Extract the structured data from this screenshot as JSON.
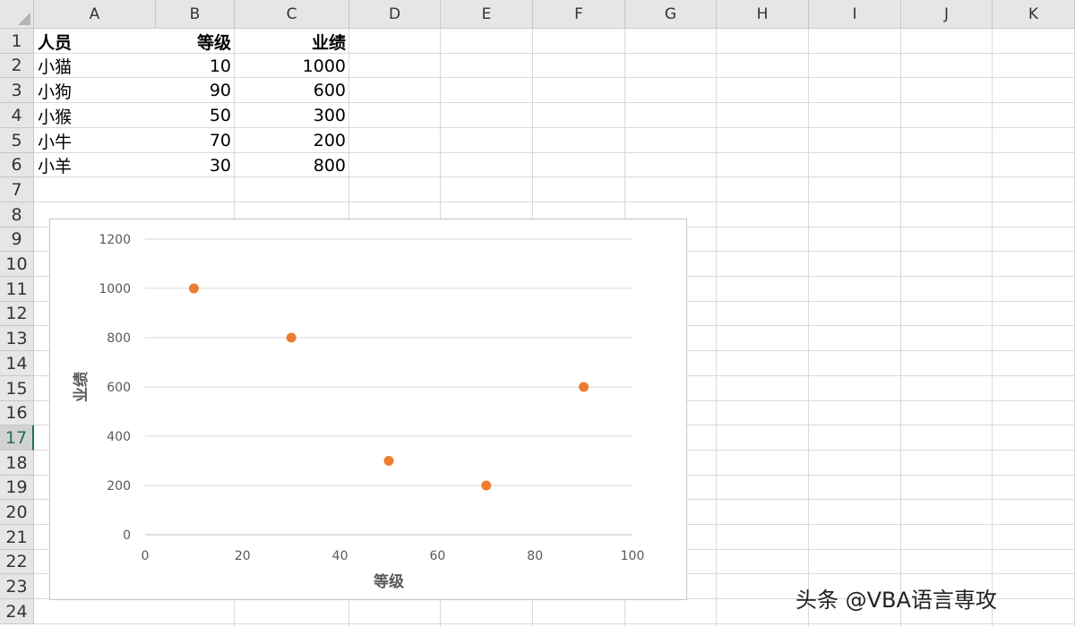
{
  "columns": [
    "A",
    "B",
    "C",
    "D",
    "E",
    "F",
    "G",
    "H",
    "I",
    "J",
    "K"
  ],
  "rows": [
    "1",
    "2",
    "3",
    "4",
    "5",
    "6",
    "7",
    "8",
    "9",
    "10",
    "11",
    "12",
    "13",
    "14",
    "15",
    "16",
    "17",
    "18",
    "19",
    "20",
    "21",
    "22",
    "23",
    "24"
  ],
  "active_row": "17",
  "table": {
    "headers": [
      "人员",
      "等级",
      "业绩"
    ],
    "rows": [
      [
        "小猫",
        "10",
        "1000"
      ],
      [
        "小狗",
        "90",
        "600"
      ],
      [
        "小猴",
        "50",
        "300"
      ],
      [
        "小牛",
        "70",
        "200"
      ],
      [
        "小羊",
        "30",
        "800"
      ]
    ]
  },
  "chart_data": {
    "type": "scatter",
    "xlabel": "等级",
    "ylabel": "业绩",
    "xlim": [
      0,
      100
    ],
    "ylim": [
      0,
      1200
    ],
    "xticks": [
      0,
      20,
      40,
      60,
      80,
      100
    ],
    "yticks": [
      0,
      200,
      400,
      600,
      800,
      1000,
      1200
    ],
    "grid": "horizontal",
    "marker_color": "#ED7D31",
    "series": [
      {
        "x": [
          10,
          90,
          50,
          70,
          30
        ],
        "y": [
          1000,
          600,
          300,
          200,
          800
        ]
      }
    ]
  },
  "watermark": "头条 @VBA语言専攻"
}
